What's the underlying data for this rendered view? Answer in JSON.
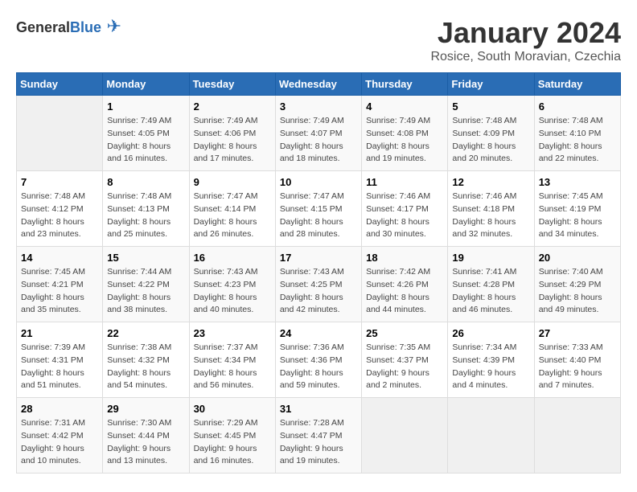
{
  "logo": {
    "general": "General",
    "blue": "Blue"
  },
  "title": "January 2024",
  "location": "Rosice, South Moravian, Czechia",
  "days_of_week": [
    "Sunday",
    "Monday",
    "Tuesday",
    "Wednesday",
    "Thursday",
    "Friday",
    "Saturday"
  ],
  "weeks": [
    [
      {
        "day": "",
        "sunrise": "",
        "sunset": "",
        "daylight": ""
      },
      {
        "day": "1",
        "sunrise": "Sunrise: 7:49 AM",
        "sunset": "Sunset: 4:05 PM",
        "daylight": "Daylight: 8 hours and 16 minutes."
      },
      {
        "day": "2",
        "sunrise": "Sunrise: 7:49 AM",
        "sunset": "Sunset: 4:06 PM",
        "daylight": "Daylight: 8 hours and 17 minutes."
      },
      {
        "day": "3",
        "sunrise": "Sunrise: 7:49 AM",
        "sunset": "Sunset: 4:07 PM",
        "daylight": "Daylight: 8 hours and 18 minutes."
      },
      {
        "day": "4",
        "sunrise": "Sunrise: 7:49 AM",
        "sunset": "Sunset: 4:08 PM",
        "daylight": "Daylight: 8 hours and 19 minutes."
      },
      {
        "day": "5",
        "sunrise": "Sunrise: 7:48 AM",
        "sunset": "Sunset: 4:09 PM",
        "daylight": "Daylight: 8 hours and 20 minutes."
      },
      {
        "day": "6",
        "sunrise": "Sunrise: 7:48 AM",
        "sunset": "Sunset: 4:10 PM",
        "daylight": "Daylight: 8 hours and 22 minutes."
      }
    ],
    [
      {
        "day": "7",
        "sunrise": "Sunrise: 7:48 AM",
        "sunset": "Sunset: 4:12 PM",
        "daylight": "Daylight: 8 hours and 23 minutes."
      },
      {
        "day": "8",
        "sunrise": "Sunrise: 7:48 AM",
        "sunset": "Sunset: 4:13 PM",
        "daylight": "Daylight: 8 hours and 25 minutes."
      },
      {
        "day": "9",
        "sunrise": "Sunrise: 7:47 AM",
        "sunset": "Sunset: 4:14 PM",
        "daylight": "Daylight: 8 hours and 26 minutes."
      },
      {
        "day": "10",
        "sunrise": "Sunrise: 7:47 AM",
        "sunset": "Sunset: 4:15 PM",
        "daylight": "Daylight: 8 hours and 28 minutes."
      },
      {
        "day": "11",
        "sunrise": "Sunrise: 7:46 AM",
        "sunset": "Sunset: 4:17 PM",
        "daylight": "Daylight: 8 hours and 30 minutes."
      },
      {
        "day": "12",
        "sunrise": "Sunrise: 7:46 AM",
        "sunset": "Sunset: 4:18 PM",
        "daylight": "Daylight: 8 hours and 32 minutes."
      },
      {
        "day": "13",
        "sunrise": "Sunrise: 7:45 AM",
        "sunset": "Sunset: 4:19 PM",
        "daylight": "Daylight: 8 hours and 34 minutes."
      }
    ],
    [
      {
        "day": "14",
        "sunrise": "Sunrise: 7:45 AM",
        "sunset": "Sunset: 4:21 PM",
        "daylight": "Daylight: 8 hours and 35 minutes."
      },
      {
        "day": "15",
        "sunrise": "Sunrise: 7:44 AM",
        "sunset": "Sunset: 4:22 PM",
        "daylight": "Daylight: 8 hours and 38 minutes."
      },
      {
        "day": "16",
        "sunrise": "Sunrise: 7:43 AM",
        "sunset": "Sunset: 4:23 PM",
        "daylight": "Daylight: 8 hours and 40 minutes."
      },
      {
        "day": "17",
        "sunrise": "Sunrise: 7:43 AM",
        "sunset": "Sunset: 4:25 PM",
        "daylight": "Daylight: 8 hours and 42 minutes."
      },
      {
        "day": "18",
        "sunrise": "Sunrise: 7:42 AM",
        "sunset": "Sunset: 4:26 PM",
        "daylight": "Daylight: 8 hours and 44 minutes."
      },
      {
        "day": "19",
        "sunrise": "Sunrise: 7:41 AM",
        "sunset": "Sunset: 4:28 PM",
        "daylight": "Daylight: 8 hours and 46 minutes."
      },
      {
        "day": "20",
        "sunrise": "Sunrise: 7:40 AM",
        "sunset": "Sunset: 4:29 PM",
        "daylight": "Daylight: 8 hours and 49 minutes."
      }
    ],
    [
      {
        "day": "21",
        "sunrise": "Sunrise: 7:39 AM",
        "sunset": "Sunset: 4:31 PM",
        "daylight": "Daylight: 8 hours and 51 minutes."
      },
      {
        "day": "22",
        "sunrise": "Sunrise: 7:38 AM",
        "sunset": "Sunset: 4:32 PM",
        "daylight": "Daylight: 8 hours and 54 minutes."
      },
      {
        "day": "23",
        "sunrise": "Sunrise: 7:37 AM",
        "sunset": "Sunset: 4:34 PM",
        "daylight": "Daylight: 8 hours and 56 minutes."
      },
      {
        "day": "24",
        "sunrise": "Sunrise: 7:36 AM",
        "sunset": "Sunset: 4:36 PM",
        "daylight": "Daylight: 8 hours and 59 minutes."
      },
      {
        "day": "25",
        "sunrise": "Sunrise: 7:35 AM",
        "sunset": "Sunset: 4:37 PM",
        "daylight": "Daylight: 9 hours and 2 minutes."
      },
      {
        "day": "26",
        "sunrise": "Sunrise: 7:34 AM",
        "sunset": "Sunset: 4:39 PM",
        "daylight": "Daylight: 9 hours and 4 minutes."
      },
      {
        "day": "27",
        "sunrise": "Sunrise: 7:33 AM",
        "sunset": "Sunset: 4:40 PM",
        "daylight": "Daylight: 9 hours and 7 minutes."
      }
    ],
    [
      {
        "day": "28",
        "sunrise": "Sunrise: 7:31 AM",
        "sunset": "Sunset: 4:42 PM",
        "daylight": "Daylight: 9 hours and 10 minutes."
      },
      {
        "day": "29",
        "sunrise": "Sunrise: 7:30 AM",
        "sunset": "Sunset: 4:44 PM",
        "daylight": "Daylight: 9 hours and 13 minutes."
      },
      {
        "day": "30",
        "sunrise": "Sunrise: 7:29 AM",
        "sunset": "Sunset: 4:45 PM",
        "daylight": "Daylight: 9 hours and 16 minutes."
      },
      {
        "day": "31",
        "sunrise": "Sunrise: 7:28 AM",
        "sunset": "Sunset: 4:47 PM",
        "daylight": "Daylight: 9 hours and 19 minutes."
      },
      {
        "day": "",
        "sunrise": "",
        "sunset": "",
        "daylight": ""
      },
      {
        "day": "",
        "sunrise": "",
        "sunset": "",
        "daylight": ""
      },
      {
        "day": "",
        "sunrise": "",
        "sunset": "",
        "daylight": ""
      }
    ]
  ]
}
